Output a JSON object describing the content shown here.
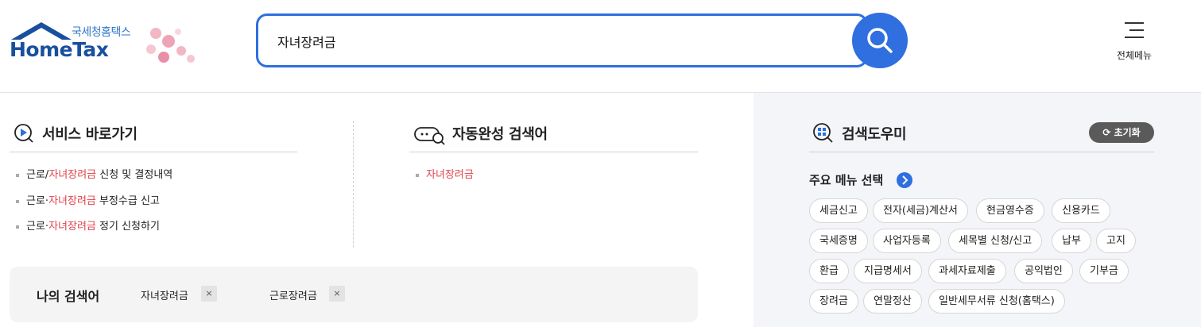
{
  "header": {
    "logo_kor": "국세청홈택스",
    "logo_en": "HomeTax",
    "search_value": "자녀장려금",
    "all_menu_label": "전체메뉴"
  },
  "shortcut": {
    "title": "서비스 바로가기",
    "items": [
      {
        "pre": "근로/",
        "hl": "자녀장려금",
        "post": " 신청 및 결정내역"
      },
      {
        "pre": "근로·",
        "hl": "자녀장려금",
        "post": " 부정수급 신고"
      },
      {
        "pre": "근로·",
        "hl": "자녀장려금",
        "post": " 정기 신청하기"
      }
    ]
  },
  "autocomplete": {
    "title": "자동완성 검색어",
    "items": [
      {
        "hl": "자녀장려금"
      }
    ]
  },
  "my_search": {
    "label": "나의 검색어",
    "keywords": [
      "자녀장려금",
      "근로장려금"
    ],
    "remove_symbol": "×"
  },
  "helper": {
    "title": "검색도우미",
    "reset_label": "초기화",
    "menu_select_label": "주요 메뉴 선택",
    "chips": [
      [
        "세금신고",
        "전자(세금)계산서",
        "현금영수증",
        "신용카드"
      ],
      [
        "국세증명",
        "사업자등록",
        "세목별 신청/신고",
        "납부",
        "고지"
      ],
      [
        "환급",
        "지급명세서",
        "과세자료제출",
        "공익법인",
        "기부금"
      ],
      [
        "장려금",
        "연말정산",
        "일반세무서류 신청(홈택스)"
      ]
    ]
  },
  "colors": {
    "accent": "#2f6fe0",
    "highlight": "#e2404a",
    "logo_blue": "#18509e"
  }
}
